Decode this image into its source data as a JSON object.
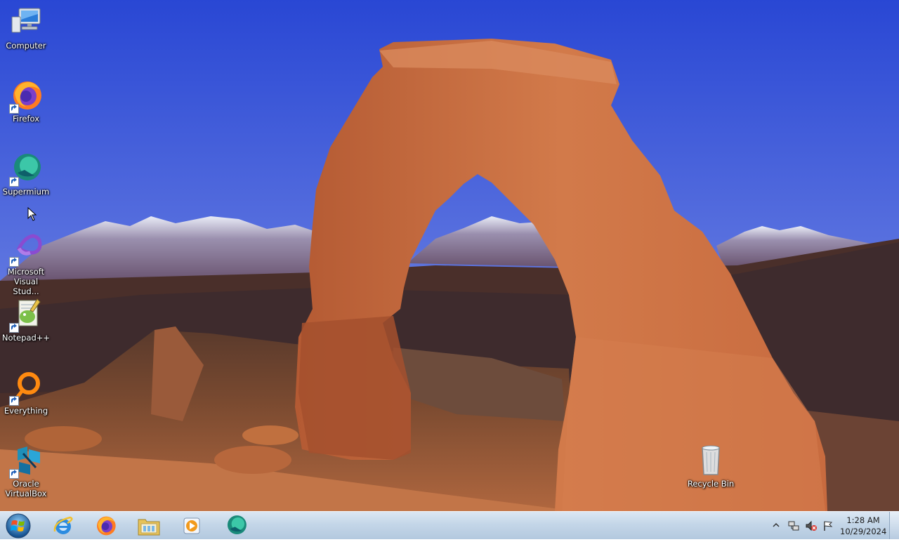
{
  "desktop": {
    "icons": [
      {
        "label": "Computer",
        "icon": "computer-icon"
      },
      {
        "label": "Firefox",
        "icon": "firefox-icon"
      },
      {
        "label": "Supermium",
        "icon": "supermium-icon"
      },
      {
        "label": "Microsoft Visual Stud...",
        "icon": "visual-studio-icon"
      },
      {
        "label": "Notepad++",
        "icon": "notepad-plus-plus-icon"
      },
      {
        "label": "Everything",
        "icon": "everything-icon"
      },
      {
        "label": "Oracle VirtualBox",
        "icon": "virtualbox-icon"
      },
      {
        "label": "Recycle Bin",
        "icon": "recycle-bin-icon"
      }
    ]
  },
  "taskbar": {
    "pinned": [
      {
        "name": "Internet Explorer",
        "icon": "internet-explorer-icon"
      },
      {
        "name": "Firefox",
        "icon": "firefox-icon"
      },
      {
        "name": "Windows Explorer",
        "icon": "file-explorer-icon"
      },
      {
        "name": "Windows Media Player",
        "icon": "media-player-icon"
      },
      {
        "name": "Supermium",
        "icon": "supermium-icon"
      }
    ],
    "tray": {
      "icons": [
        "show-hidden-icons-arrow",
        "network-icon",
        "volume-muted-icon",
        "action-center-flag-icon"
      ],
      "time": "1:28 AM",
      "date": "10/29/2024"
    }
  },
  "colors": {
    "sky_top": "#2c4fd6",
    "sky_bottom": "#8fa3e6",
    "arch": "#c0643a",
    "taskbar": "#c4d6e8"
  }
}
